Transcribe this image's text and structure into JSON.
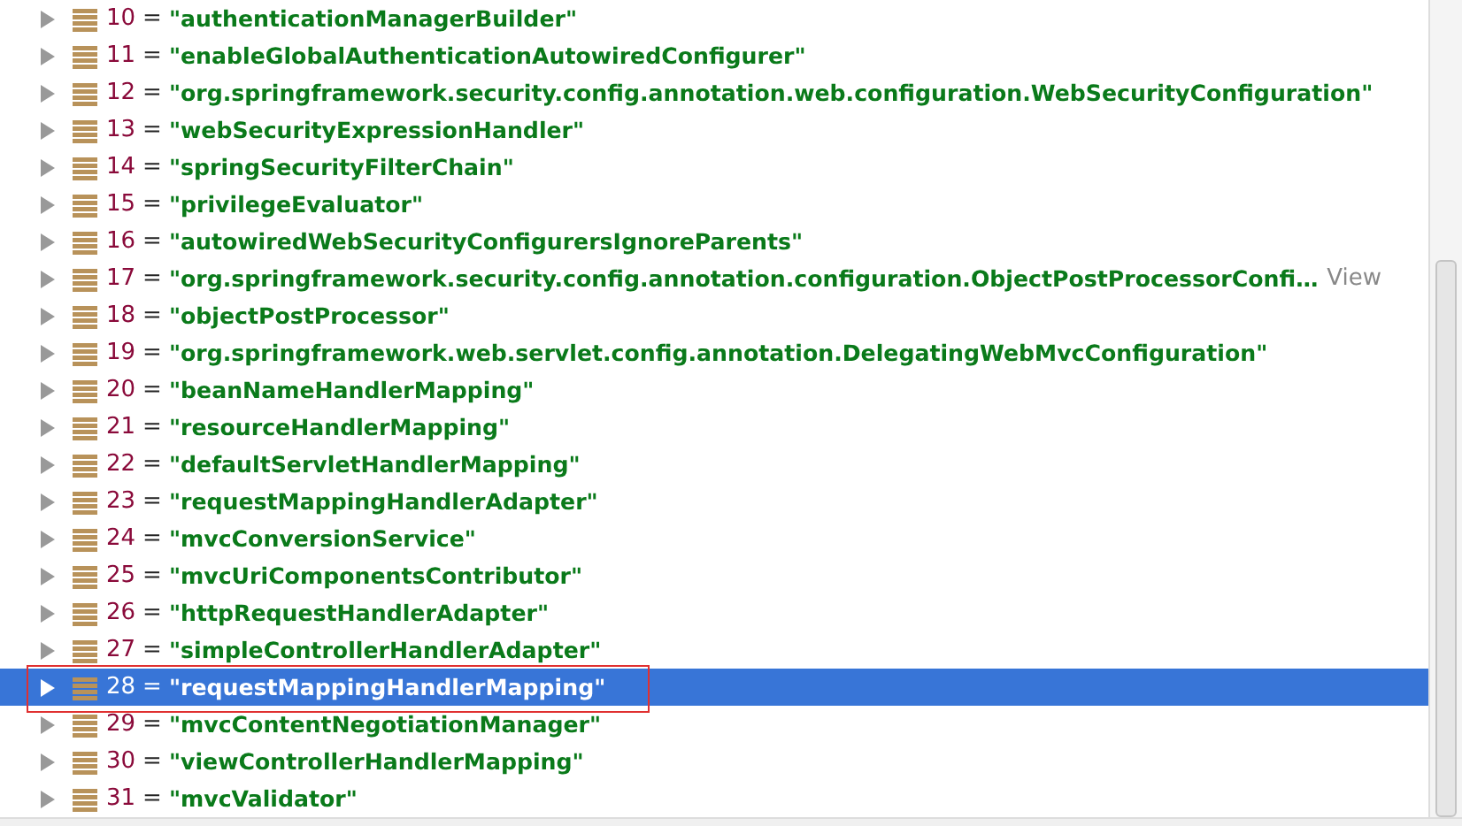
{
  "rows": [
    {
      "index": "10",
      "separator": "=",
      "value": "\"authenticationManagerBuilder\"",
      "selected": false
    },
    {
      "index": "11",
      "separator": "=",
      "value": "\"enableGlobalAuthenticationAutowiredConfigurer\"",
      "selected": false
    },
    {
      "index": "12",
      "separator": "=",
      "value": "\"org.springframework.security.config.annotation.web.configuration.WebSecurityConfiguration\"",
      "selected": false
    },
    {
      "index": "13",
      "separator": "=",
      "value": "\"webSecurityExpressionHandler\"",
      "selected": false
    },
    {
      "index": "14",
      "separator": "=",
      "value": "\"springSecurityFilterChain\"",
      "selected": false
    },
    {
      "index": "15",
      "separator": "=",
      "value": "\"privilegeEvaluator\"",
      "selected": false
    },
    {
      "index": "16",
      "separator": "=",
      "value": "\"autowiredWebSecurityConfigurersIgnoreParents\"",
      "selected": false
    },
    {
      "index": "17",
      "separator": "=",
      "value": "\"org.springframework.security.config.annotation.configuration.ObjectPostProcessorConfi…",
      "link": "View",
      "selected": false
    },
    {
      "index": "18",
      "separator": "=",
      "value": "\"objectPostProcessor\"",
      "selected": false
    },
    {
      "index": "19",
      "separator": "=",
      "value": "\"org.springframework.web.servlet.config.annotation.DelegatingWebMvcConfiguration\"",
      "selected": false
    },
    {
      "index": "20",
      "separator": "=",
      "value": "\"beanNameHandlerMapping\"",
      "selected": false
    },
    {
      "index": "21",
      "separator": "=",
      "value": "\"resourceHandlerMapping\"",
      "selected": false
    },
    {
      "index": "22",
      "separator": "=",
      "value": "\"defaultServletHandlerMapping\"",
      "selected": false
    },
    {
      "index": "23",
      "separator": "=",
      "value": "\"requestMappingHandlerAdapter\"",
      "selected": false
    },
    {
      "index": "24",
      "separator": "=",
      "value": "\"mvcConversionService\"",
      "selected": false
    },
    {
      "index": "25",
      "separator": "=",
      "value": "\"mvcUriComponentsContributor\"",
      "selected": false
    },
    {
      "index": "26",
      "separator": "=",
      "value": "\"httpRequestHandlerAdapter\"",
      "selected": false
    },
    {
      "index": "27",
      "separator": "=",
      "value": "\"simpleControllerHandlerAdapter\"",
      "selected": false
    },
    {
      "index": "28",
      "separator": "=",
      "value": "\"requestMappingHandlerMapping\"",
      "selected": true,
      "annotated": true
    },
    {
      "index": "29",
      "separator": "=",
      "value": "\"mvcContentNegotiationManager\"",
      "selected": false
    },
    {
      "index": "30",
      "separator": "=",
      "value": "\"viewControllerHandlerMapping\"",
      "selected": false
    },
    {
      "index": "31",
      "separator": "=",
      "value": "\"mvcValidator\"",
      "selected": false
    }
  ]
}
